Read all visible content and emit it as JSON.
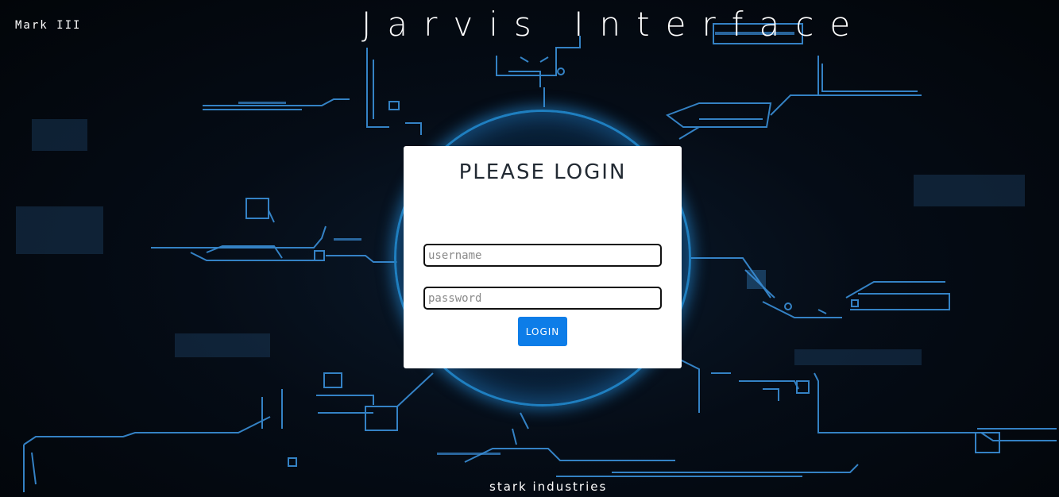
{
  "header": {
    "mark_label": "Mark III",
    "title": "Jarvis Interface"
  },
  "login": {
    "heading": "PLEASE LOGIN",
    "username_placeholder": "username",
    "username_value": "",
    "password_placeholder": "password",
    "password_value": "",
    "button_label": "LOGIN"
  },
  "footer": {
    "company": "stark industries"
  },
  "colors": {
    "background": "#03070d",
    "circuit": "#3a8fd8",
    "card": "#ffffff",
    "button": "#0d7de8",
    "ring": "#1f7fc0"
  }
}
